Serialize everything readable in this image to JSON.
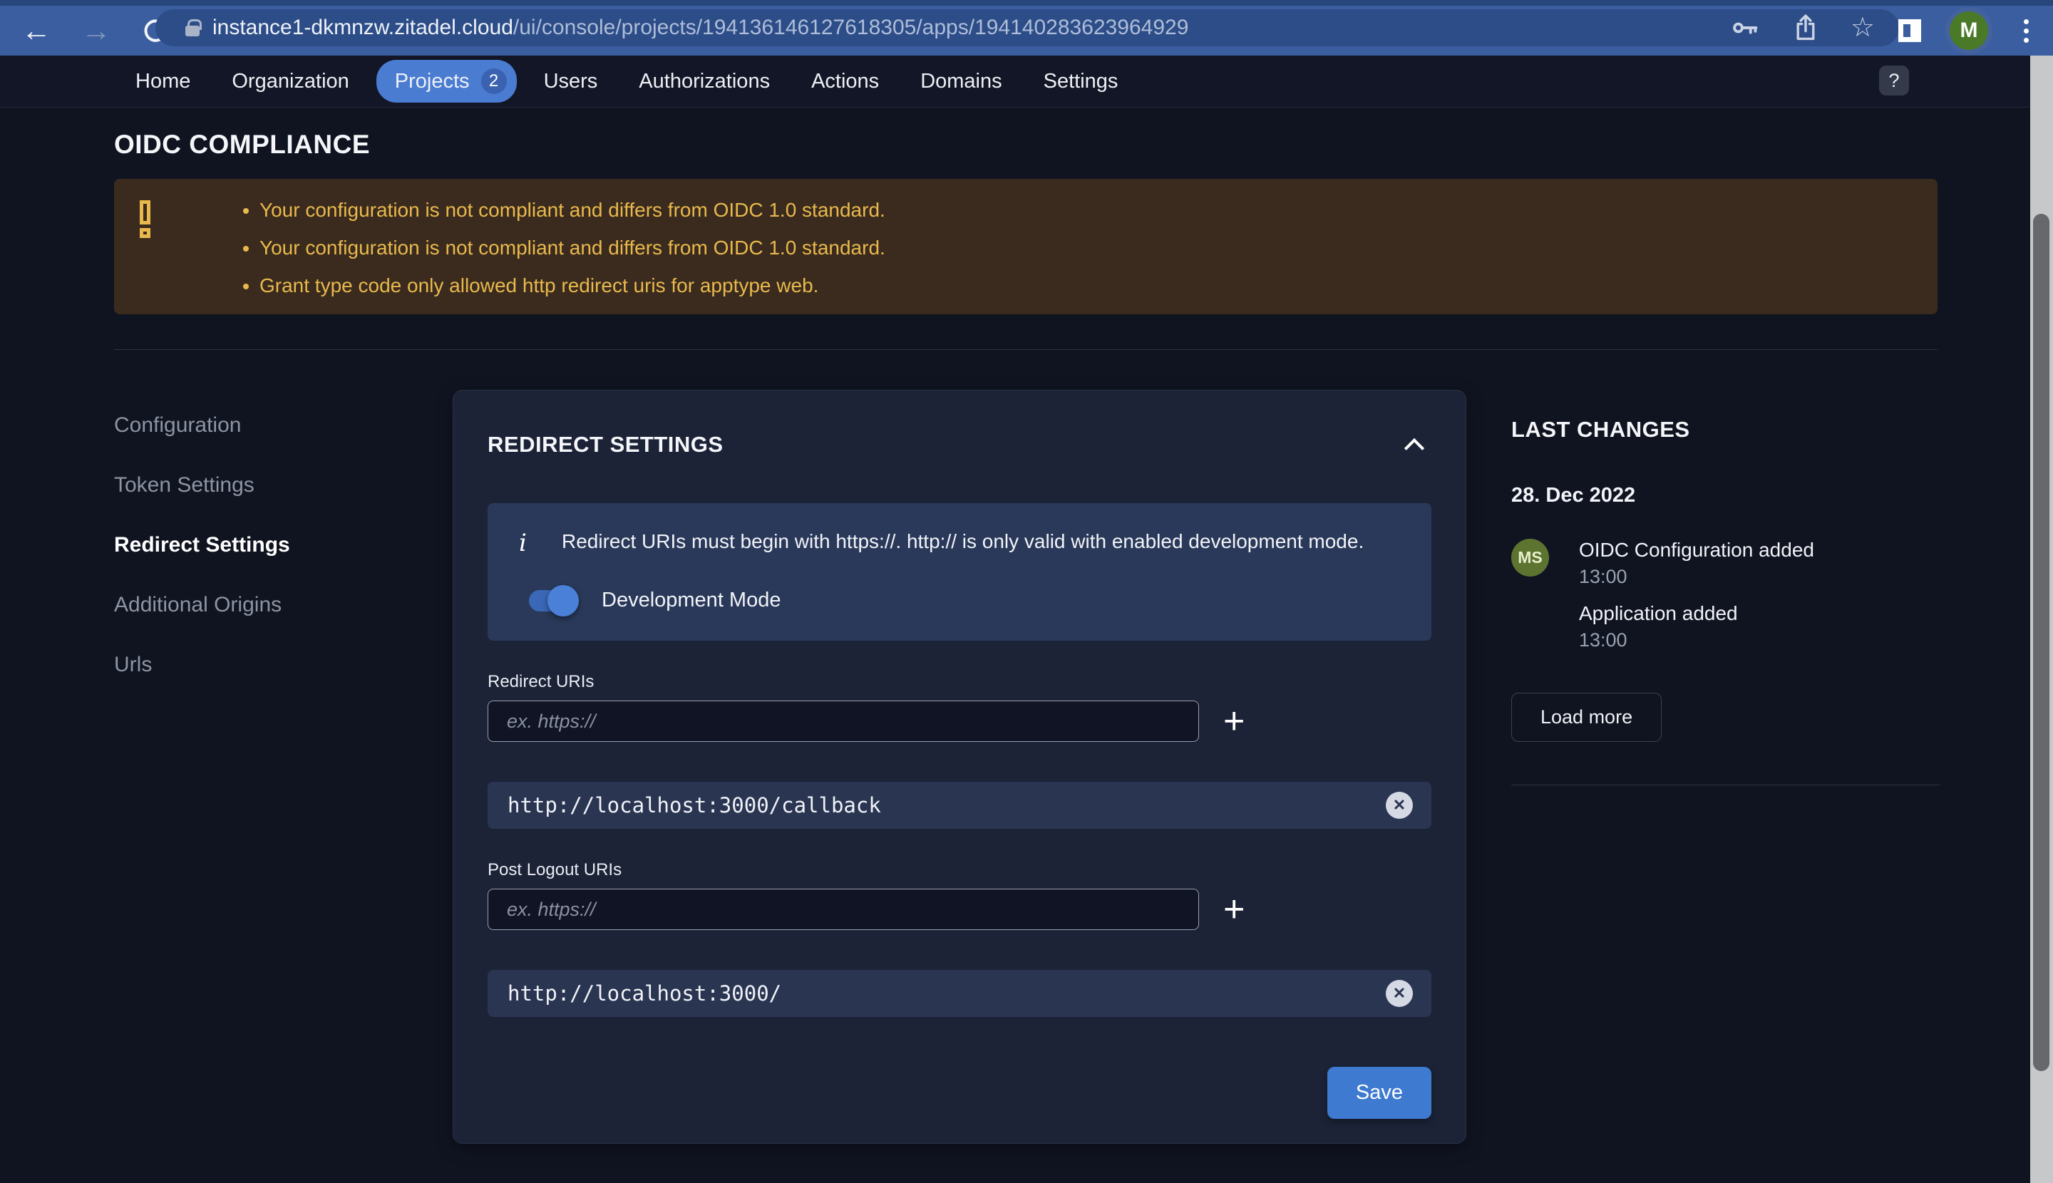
{
  "browser": {
    "url_host": "instance1-dkmnzw.zitadel.cloud",
    "url_path": "/ui/console/projects/194136146127618305/apps/194140283623964929",
    "avatar_initial": "M"
  },
  "nav": {
    "items": [
      {
        "label": "Home",
        "active": false
      },
      {
        "label": "Organization",
        "active": false
      },
      {
        "label": "Projects",
        "active": true,
        "badge": "2"
      },
      {
        "label": "Users",
        "active": false
      },
      {
        "label": "Authorizations",
        "active": false
      },
      {
        "label": "Actions",
        "active": false
      },
      {
        "label": "Domains",
        "active": false
      },
      {
        "label": "Settings",
        "active": false
      }
    ],
    "help_label": "?"
  },
  "page": {
    "title": "OIDC COMPLIANCE",
    "warnings": [
      "Your configuration is not compliant and differs from OIDC 1.0 standard.",
      "Your configuration is not compliant and differs from OIDC 1.0 standard.",
      "Grant type code only allowed http redirect uris for apptype web."
    ]
  },
  "sidebar": {
    "items": [
      {
        "label": "Configuration",
        "active": false
      },
      {
        "label": "Token Settings",
        "active": false
      },
      {
        "label": "Redirect Settings",
        "active": true
      },
      {
        "label": "Additional Origins",
        "active": false
      },
      {
        "label": "Urls",
        "active": false
      }
    ]
  },
  "card": {
    "title": "REDIRECT SETTINGS",
    "info_text": "Redirect URIs must begin with https://. http:// is only valid with enabled development mode.",
    "dev_mode_label": "Development Mode",
    "dev_mode_on": true,
    "redirect_label": "Redirect URIs",
    "redirect_placeholder": "ex. https://",
    "redirect_uris": [
      "http://localhost:3000/callback"
    ],
    "post_logout_label": "Post Logout URIs",
    "post_logout_placeholder": "ex. https://",
    "post_logout_uris": [
      "http://localhost:3000/"
    ],
    "save_label": "Save"
  },
  "changes": {
    "title": "LAST CHANGES",
    "date": "28. Dec 2022",
    "avatar_initials": "MS",
    "entries": [
      {
        "title": "OIDC Configuration added",
        "time": "13:00"
      },
      {
        "title": "Application added",
        "time": "13:00"
      }
    ],
    "load_more_label": "Load more"
  },
  "icons": {
    "back": "←",
    "forward": "→",
    "star": "☆",
    "plus": "+",
    "close": "✕"
  },
  "colors": {
    "accent_blue": "#4a7cd2",
    "save_blue": "#3e7ad0",
    "warning_bg": "#3a2b1e",
    "warning_text": "#e9b94d",
    "card_bg": "#1c2337",
    "info_panel_bg": "#2a3959",
    "chip_bg": "#2a3552",
    "avatar_green": "#5c7430",
    "browser_bar_blue": "#3a5e9f"
  }
}
